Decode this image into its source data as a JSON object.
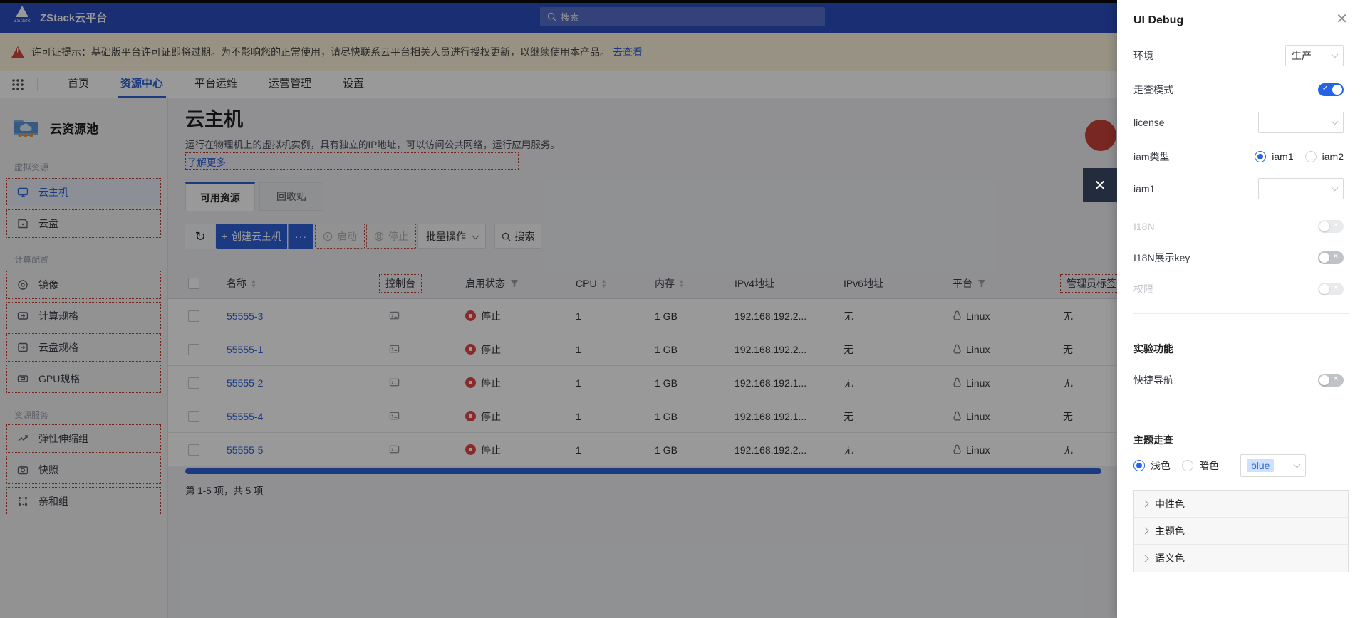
{
  "topbar": {
    "brand": "ZStack云平台",
    "search_placeholder": "搜索"
  },
  "banner": {
    "text": "许可证提示：基础版平台许可证即将过期。为不影响您的正常使用，请尽快联系云平台相关人员进行授权更新，以继续使用本产品。",
    "link": "去查看"
  },
  "nav": {
    "items": [
      {
        "label": "首页"
      },
      {
        "label": "资源中心"
      },
      {
        "label": "平台运维"
      },
      {
        "label": "运营管理"
      },
      {
        "label": "设置"
      }
    ]
  },
  "sidebar": {
    "title": "云资源池",
    "groups": [
      {
        "label": "虚拟资源",
        "items": [
          {
            "label": "云主机",
            "icon": "vm-monitor-icon"
          },
          {
            "label": "云盘",
            "icon": "volume-icon"
          }
        ]
      },
      {
        "label": "计算配置",
        "items": [
          {
            "label": "镜像",
            "icon": "image-icon"
          },
          {
            "label": "计算规格",
            "icon": "instance-offering-icon"
          },
          {
            "label": "云盘规格",
            "icon": "volume-offering-icon"
          },
          {
            "label": "GPU规格",
            "icon": "gpu-icon"
          }
        ]
      },
      {
        "label": "资源服务",
        "items": [
          {
            "label": "弹性伸缩组",
            "icon": "autoscaling-icon"
          },
          {
            "label": "快照",
            "icon": "snapshot-icon"
          },
          {
            "label": "亲和组",
            "icon": "affinity-group-icon"
          }
        ]
      }
    ]
  },
  "page": {
    "title": "云主机",
    "subtitle": "运行在物理机上的虚拟机实例，具有独立的IP地址，可以访问公共网络，运行应用服务。",
    "more_link": "了解更多"
  },
  "tabs": [
    {
      "label": "可用资源"
    },
    {
      "label": "回收站"
    }
  ],
  "toolbar": {
    "create": "创建云主机",
    "more": "···",
    "start": "启动",
    "stop": "停止",
    "batch": "批量操作",
    "search": "搜索"
  },
  "table": {
    "columns": [
      {
        "label": "名称"
      },
      {
        "label": "控制台"
      },
      {
        "label": "启用状态"
      },
      {
        "label": "CPU"
      },
      {
        "label": "内存"
      },
      {
        "label": "IPv4地址"
      },
      {
        "label": "IPv6地址"
      },
      {
        "label": "平台"
      },
      {
        "label": "管理员标签"
      }
    ],
    "rows": [
      {
        "name": "55555-3",
        "status": "停止",
        "cpu": "1",
        "mem": "1 GB",
        "ipv4": "192.168.192.2...",
        "ipv6": "无",
        "platform": "Linux",
        "tag": "无"
      },
      {
        "name": "55555-1",
        "status": "停止",
        "cpu": "1",
        "mem": "1 GB",
        "ipv4": "192.168.192.2...",
        "ipv6": "无",
        "platform": "Linux",
        "tag": "无"
      },
      {
        "name": "55555-2",
        "status": "停止",
        "cpu": "1",
        "mem": "1 GB",
        "ipv4": "192.168.192.1...",
        "ipv6": "无",
        "platform": "Linux",
        "tag": "无"
      },
      {
        "name": "55555-4",
        "status": "停止",
        "cpu": "1",
        "mem": "1 GB",
        "ipv4": "192.168.192.1...",
        "ipv6": "无",
        "platform": "Linux",
        "tag": "无"
      },
      {
        "name": "55555-5",
        "status": "停止",
        "cpu": "1",
        "mem": "1 GB",
        "ipv4": "192.168.192.2...",
        "ipv6": "无",
        "platform": "Linux",
        "tag": "无"
      }
    ],
    "footer": "第 1-5 项，共 5 项"
  },
  "debug_panel": {
    "title": "UI Debug",
    "env_label": "环境",
    "env_value": "生产",
    "walkthrough_label": "走查模式",
    "license_label": "license",
    "iam_type_label": "iam类型",
    "iam_option1": "iam1",
    "iam_option2": "iam2",
    "iam1_label": "iam1",
    "i18n_label": "I18N",
    "i18n_key_label": "I18N展示key",
    "perm_label": "权限",
    "experimental_label": "实验功能",
    "quick_nav_label": "快捷导航",
    "theme_label": "主题走查",
    "theme_light": "浅色",
    "theme_dark": "暗色",
    "theme_color": "blue",
    "color_groups": [
      {
        "label": "中性色"
      },
      {
        "label": "主题色"
      },
      {
        "label": "语义色"
      }
    ]
  },
  "colors": {
    "accent": "#2e62d9",
    "toggle_on": "#2563e6",
    "danger": "#e84749",
    "debug_outline": "#c0392b",
    "topbar": "#2b4ec0"
  }
}
